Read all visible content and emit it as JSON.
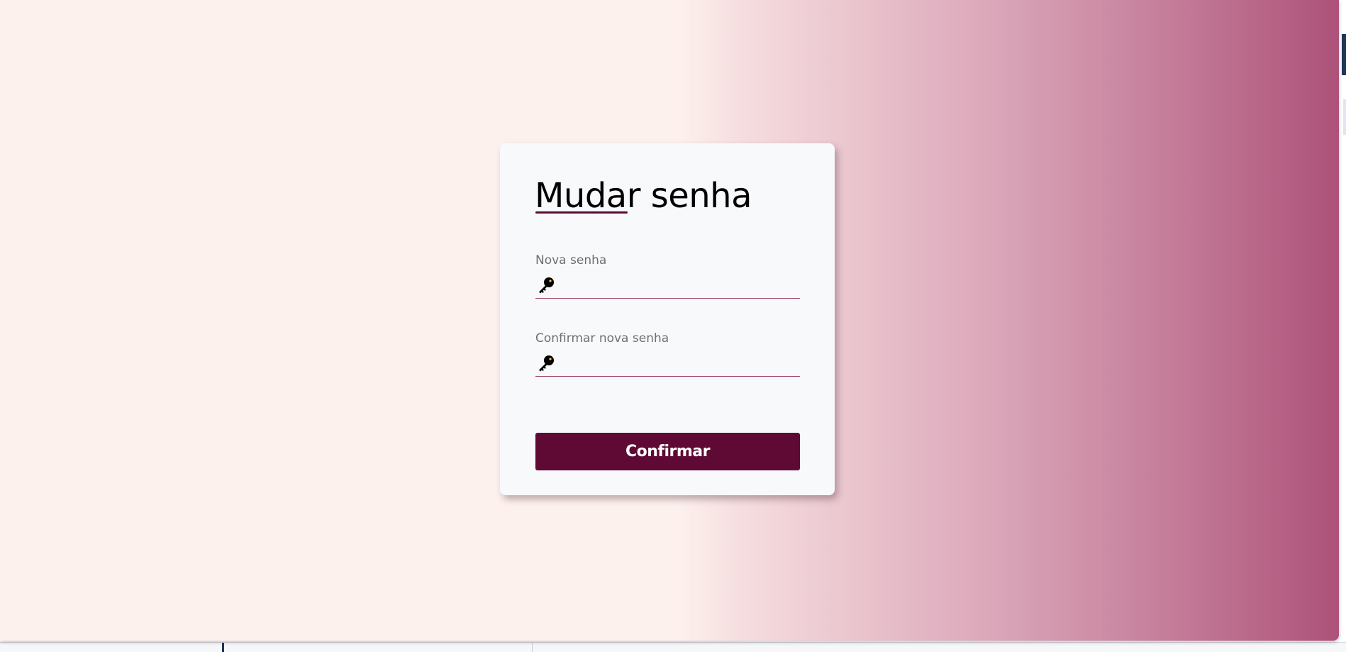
{
  "page": {
    "background_gradient": [
      "#fdf1ee",
      "#ad5279"
    ]
  },
  "form": {
    "title": "Mudar senha",
    "new_password": {
      "label": "Nova senha",
      "icon": "key-icon",
      "value": ""
    },
    "confirm_password": {
      "label": "Confirmar nova senha",
      "icon": "key-icon",
      "value": ""
    },
    "submit_label": "Confirmar"
  },
  "colors": {
    "accent": "#5f0a35",
    "field_border": "#a4436e",
    "card_bg": "#f8f9fb",
    "label": "#6f6f72"
  }
}
